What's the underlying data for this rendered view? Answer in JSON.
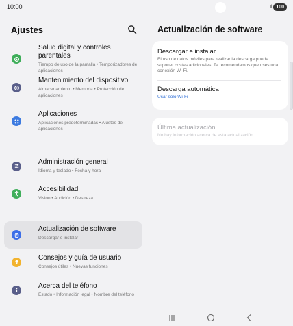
{
  "status": {
    "time": "10:00",
    "signal": ".ıl",
    "battery": "100"
  },
  "left": {
    "title": "Ajustes",
    "items": [
      {
        "title": "Salud digital y controles parentales",
        "sub": "Tiempo de uso de la pantalla • Temporizadores de aplicaciones",
        "icon": "wellbeing-icon",
        "color": "#3fae5a"
      },
      {
        "title": "Mantenimiento del dispositivo",
        "sub": "Almacenamiento • Memoria • Protección de aplicaciones",
        "icon": "device-care-icon",
        "color": "#5a5f8a"
      },
      {
        "title": "Aplicaciones",
        "sub": "Aplicaciones predeterminadas • Ajustes de aplicaciones",
        "icon": "apps-icon",
        "color": "#3d7be0"
      },
      {
        "title": "Administración general",
        "sub": "Idioma y teclado • Fecha y hora",
        "icon": "sliders-icon",
        "color": "#5a5f8a"
      },
      {
        "title": "Accesibilidad",
        "sub": "Visión • Audición • Destreza",
        "icon": "accessibility-icon",
        "color": "#3fae5a"
      },
      {
        "title": "Actualización de software",
        "sub": "Descargar e instalar",
        "icon": "software-update-icon",
        "color": "#3d6ee8"
      },
      {
        "title": "Consejos y guía de usuario",
        "sub": "Consejos útiles • Nuevas funciones",
        "icon": "tips-icon",
        "color": "#f2b32e"
      },
      {
        "title": "Acerca del teléfono",
        "sub": "Estado • Información legal • Nombre del teléfono",
        "icon": "info-icon",
        "color": "#5a5f8a"
      }
    ]
  },
  "right": {
    "title": "Actualización de software",
    "download": {
      "title": "Descargar e instalar",
      "sub": "El uso de datos móviles para realizar la descarga puede suponer costes adicionales. Te recomendamos que uses una conexión Wi-Fi."
    },
    "auto": {
      "title": "Descarga automática",
      "sub": "Usar solo Wi-Fi"
    },
    "last": {
      "title": "Última actualización",
      "sub": "No hay información acerca de esta actualización."
    }
  },
  "nav": {
    "recents": "recents-icon",
    "home": "home-icon",
    "back": "back-icon"
  }
}
